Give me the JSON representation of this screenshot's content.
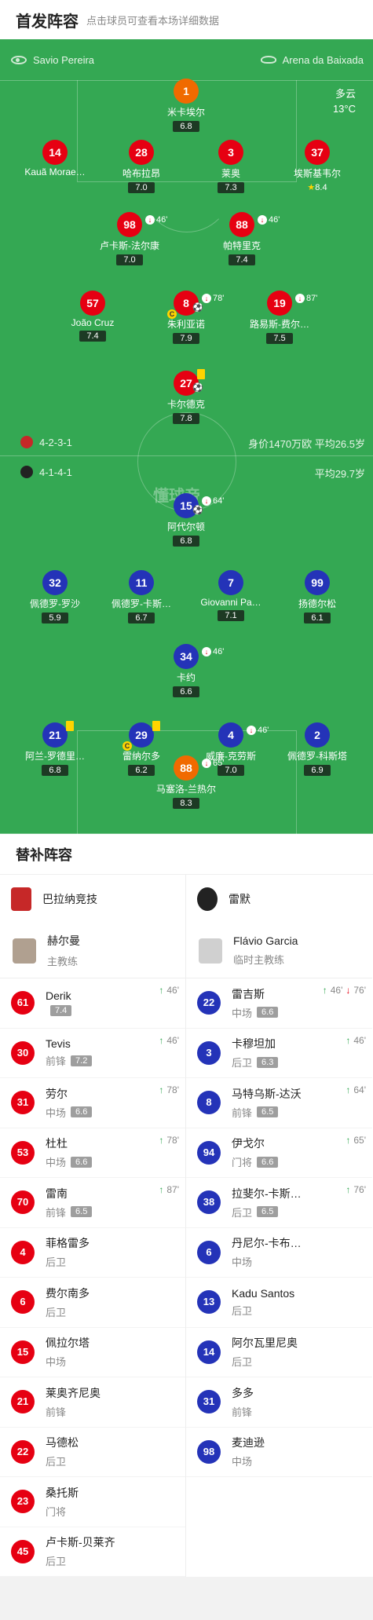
{
  "header": {
    "title": "首发阵容",
    "subtitle": "点击球员可查看本场详细数据"
  },
  "pitch": {
    "referee": "Savio Pereira",
    "stadium": "Arena da Baixada",
    "weather": "多云",
    "temperature": "13°C",
    "home_formation": "4-2-3-1",
    "home_value": "身价1470万欧 平均26.5岁",
    "away_formation": "4-1-4-1",
    "away_age": "平均29.7岁",
    "brand": "懂球帝"
  },
  "home_players": [
    {
      "num": "1",
      "name": "米卡埃尔",
      "rating": "6.8"
    },
    {
      "num": "14",
      "name": "Kauã Morae…",
      "rating": ""
    },
    {
      "num": "28",
      "name": "哈布拉昂",
      "rating": "7.0"
    },
    {
      "num": "3",
      "name": "莱奥",
      "rating": "7.3"
    },
    {
      "num": "37",
      "name": "埃斯基韦尔",
      "rating": "8.4"
    },
    {
      "num": "98",
      "name": "卢卡斯-法尔康",
      "rating": "7.0",
      "sub": "46'"
    },
    {
      "num": "88",
      "name": "帕特里克",
      "rating": "7.4",
      "sub": "46'"
    },
    {
      "num": "57",
      "name": "João Cruz",
      "rating": "7.4"
    },
    {
      "num": "8",
      "name": "朱利亚诺",
      "rating": "7.9",
      "sub": "78'"
    },
    {
      "num": "19",
      "name": "路易斯-费尔…",
      "rating": "7.5",
      "sub": "87'"
    },
    {
      "num": "27",
      "name": "卡尔德克",
      "rating": "7.8"
    }
  ],
  "away_players": [
    {
      "num": "15",
      "name": "阿代尔顿",
      "rating": "6.8",
      "sub": "64'"
    },
    {
      "num": "32",
      "name": "佩德罗-罗沙",
      "rating": "5.9"
    },
    {
      "num": "11",
      "name": "佩德罗-卡斯…",
      "rating": "6.7"
    },
    {
      "num": "7",
      "name": "Giovanni Pa…",
      "rating": "7.1"
    },
    {
      "num": "99",
      "name": "扬德尔松",
      "rating": "6.1"
    },
    {
      "num": "34",
      "name": "卡约",
      "rating": "6.6",
      "sub": "46'"
    },
    {
      "num": "21",
      "name": "阿兰-罗德里…",
      "rating": "6.8"
    },
    {
      "num": "29",
      "name": "雷纳尔多",
      "rating": "6.2"
    },
    {
      "num": "4",
      "name": "威廉-克劳斯",
      "rating": "7.0",
      "sub": "46'"
    },
    {
      "num": "2",
      "name": "佩德罗-科斯塔",
      "rating": "6.9"
    },
    {
      "num": "88",
      "name": "马塞洛-兰热尔",
      "rating": "8.3",
      "sub": "65'"
    }
  ],
  "subs_title": "替补阵容",
  "home_team": {
    "name": "巴拉纳竞技",
    "coach": "赫尔曼",
    "coach_role": "主教练",
    "subs": [
      {
        "num": "61",
        "name": "Derik",
        "pos": "",
        "rating": "7.4",
        "in": "46'"
      },
      {
        "num": "30",
        "name": "Tevis",
        "pos": "前锋",
        "rating": "7.2",
        "in": "46'"
      },
      {
        "num": "31",
        "name": "劳尔",
        "pos": "中场",
        "rating": "6.6",
        "in": "78'"
      },
      {
        "num": "53",
        "name": "杜杜",
        "pos": "中场",
        "rating": "6.6",
        "in": "78'"
      },
      {
        "num": "70",
        "name": "雷南",
        "pos": "前锋",
        "rating": "6.5",
        "in": "87'"
      },
      {
        "num": "4",
        "name": "菲格雷多",
        "pos": "后卫"
      },
      {
        "num": "6",
        "name": "费尔南多",
        "pos": "后卫"
      },
      {
        "num": "15",
        "name": "佩拉尔塔",
        "pos": "中场"
      },
      {
        "num": "21",
        "name": "莱奥齐尼奥",
        "pos": "前锋"
      },
      {
        "num": "22",
        "name": "马德松",
        "pos": "后卫"
      },
      {
        "num": "23",
        "name": "桑托斯",
        "pos": "门将"
      },
      {
        "num": "45",
        "name": "卢卡斯-贝莱齐",
        "pos": "后卫"
      }
    ]
  },
  "away_team": {
    "name": "雷默",
    "coach": "Flávio Garcia",
    "coach_role": "临时主教练",
    "subs": [
      {
        "num": "22",
        "name": "雷吉斯",
        "pos": "中场",
        "rating": "6.6",
        "in": "46'",
        "out": "76'"
      },
      {
        "num": "3",
        "name": "卡穆坦加",
        "pos": "后卫",
        "rating": "6.3",
        "in": "46'"
      },
      {
        "num": "8",
        "name": "马特乌斯-达沃",
        "pos": "前锋",
        "rating": "6.5",
        "in": "64'"
      },
      {
        "num": "94",
        "name": "伊戈尔",
        "pos": "门将",
        "rating": "6.6",
        "in": "65'"
      },
      {
        "num": "38",
        "name": "拉斐尔-卡斯…",
        "pos": "后卫",
        "rating": "6.5",
        "in": "76'"
      },
      {
        "num": "6",
        "name": "丹尼尔-卡布…",
        "pos": "中场"
      },
      {
        "num": "13",
        "name": "Kadu Santos",
        "pos": "后卫"
      },
      {
        "num": "14",
        "name": "阿尔瓦里尼奥",
        "pos": "后卫"
      },
      {
        "num": "31",
        "name": "多多",
        "pos": "前锋"
      },
      {
        "num": "98",
        "name": "麦迪逊",
        "pos": "中场"
      }
    ]
  }
}
